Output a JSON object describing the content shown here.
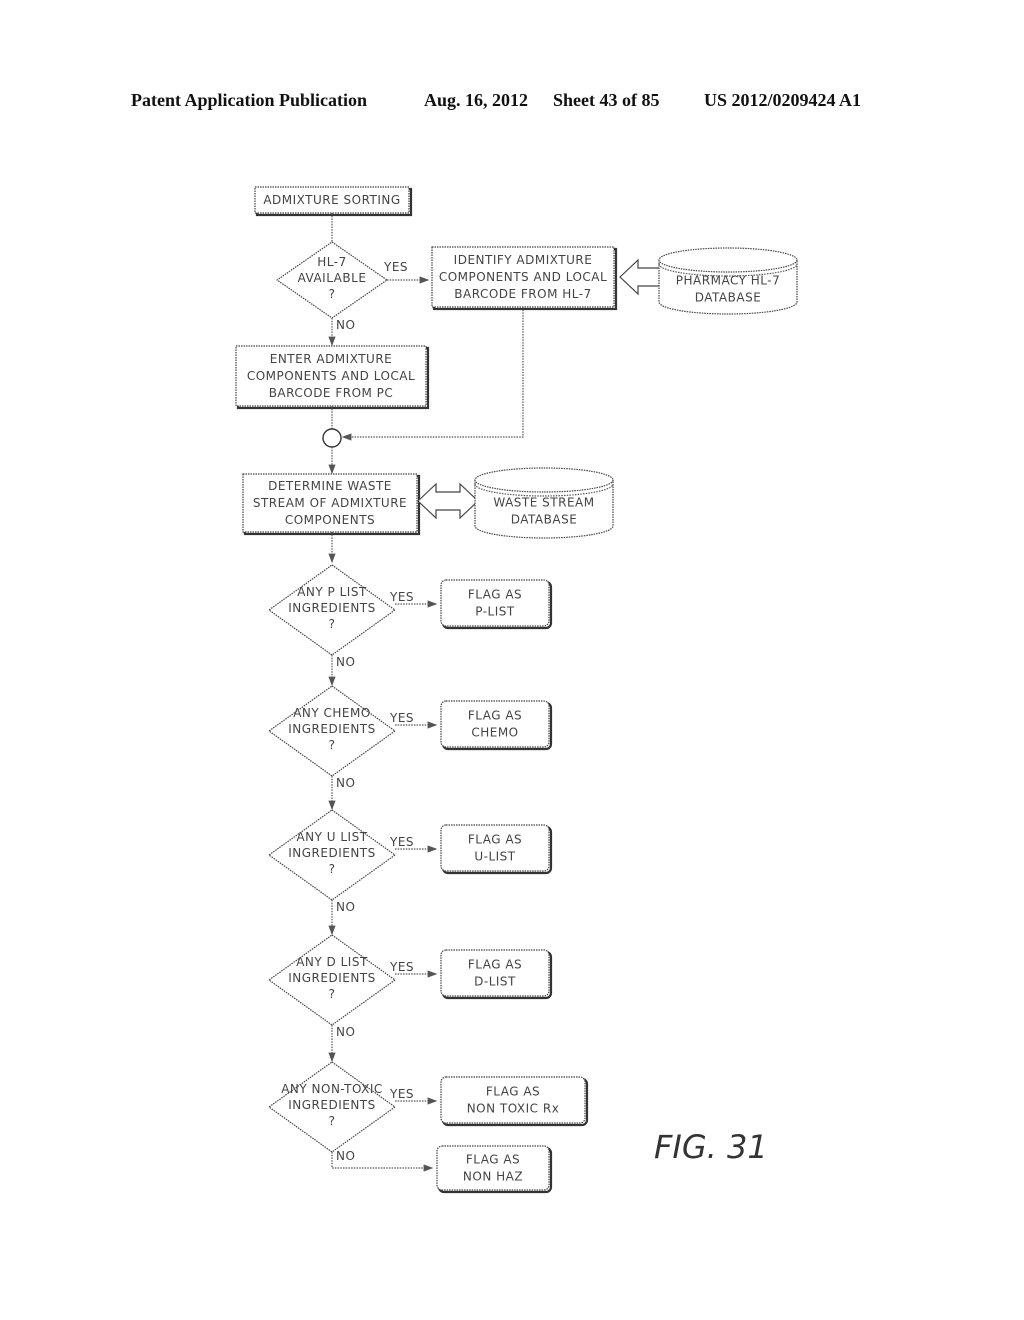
{
  "header": {
    "publication": "Patent Application Publication",
    "date": "Aug. 16, 2012",
    "sheet": "Sheet 43 of 85",
    "number": "US 2012/0209424 A1"
  },
  "figure_label": "FIG. 31",
  "nodes": {
    "start": [
      "ADMIXTURE SORTING"
    ],
    "hl7_decision": [
      "HL-7",
      "AVAILABLE",
      "?"
    ],
    "identify": [
      "IDENTIFY ADMIXTURE",
      "COMPONENTS AND LOCAL",
      "BARCODE FROM HL-7"
    ],
    "pharmacy_db": [
      "PHARMACY HL-7",
      "DATABASE"
    ],
    "enter": [
      "ENTER ADMIXTURE",
      "COMPONENTS AND LOCAL",
      "BARCODE FROM PC"
    ],
    "determine": [
      "DETERMINE WASTE",
      "STREAM OF ADMIXTURE",
      "COMPONENTS"
    ],
    "waste_db": [
      "WASTE STREAM",
      "DATABASE"
    ],
    "decisions": [
      {
        "q": [
          "ANY P LIST",
          "INGREDIENTS",
          "?"
        ],
        "flag": [
          "FLAG AS",
          "P-LIST"
        ]
      },
      {
        "q": [
          "ANY CHEMO",
          "INGREDIENTS",
          "?"
        ],
        "flag": [
          "FLAG AS",
          "CHEMO"
        ]
      },
      {
        "q": [
          "ANY U LIST",
          "INGREDIENTS",
          "?"
        ],
        "flag": [
          "FLAG AS",
          "U-LIST"
        ]
      },
      {
        "q": [
          "ANY D LIST",
          "INGREDIENTS",
          "?"
        ],
        "flag": [
          "FLAG AS",
          "D-LIST"
        ]
      },
      {
        "q": [
          "ANY NON-TOXIC",
          "INGREDIENTS",
          "?"
        ],
        "flag": [
          "FLAG AS",
          "NON TOXIC Rx"
        ]
      }
    ],
    "final": [
      "FLAG AS",
      "NON HAZ"
    ]
  },
  "edge_labels": {
    "yes": "YES",
    "no": "NO"
  }
}
